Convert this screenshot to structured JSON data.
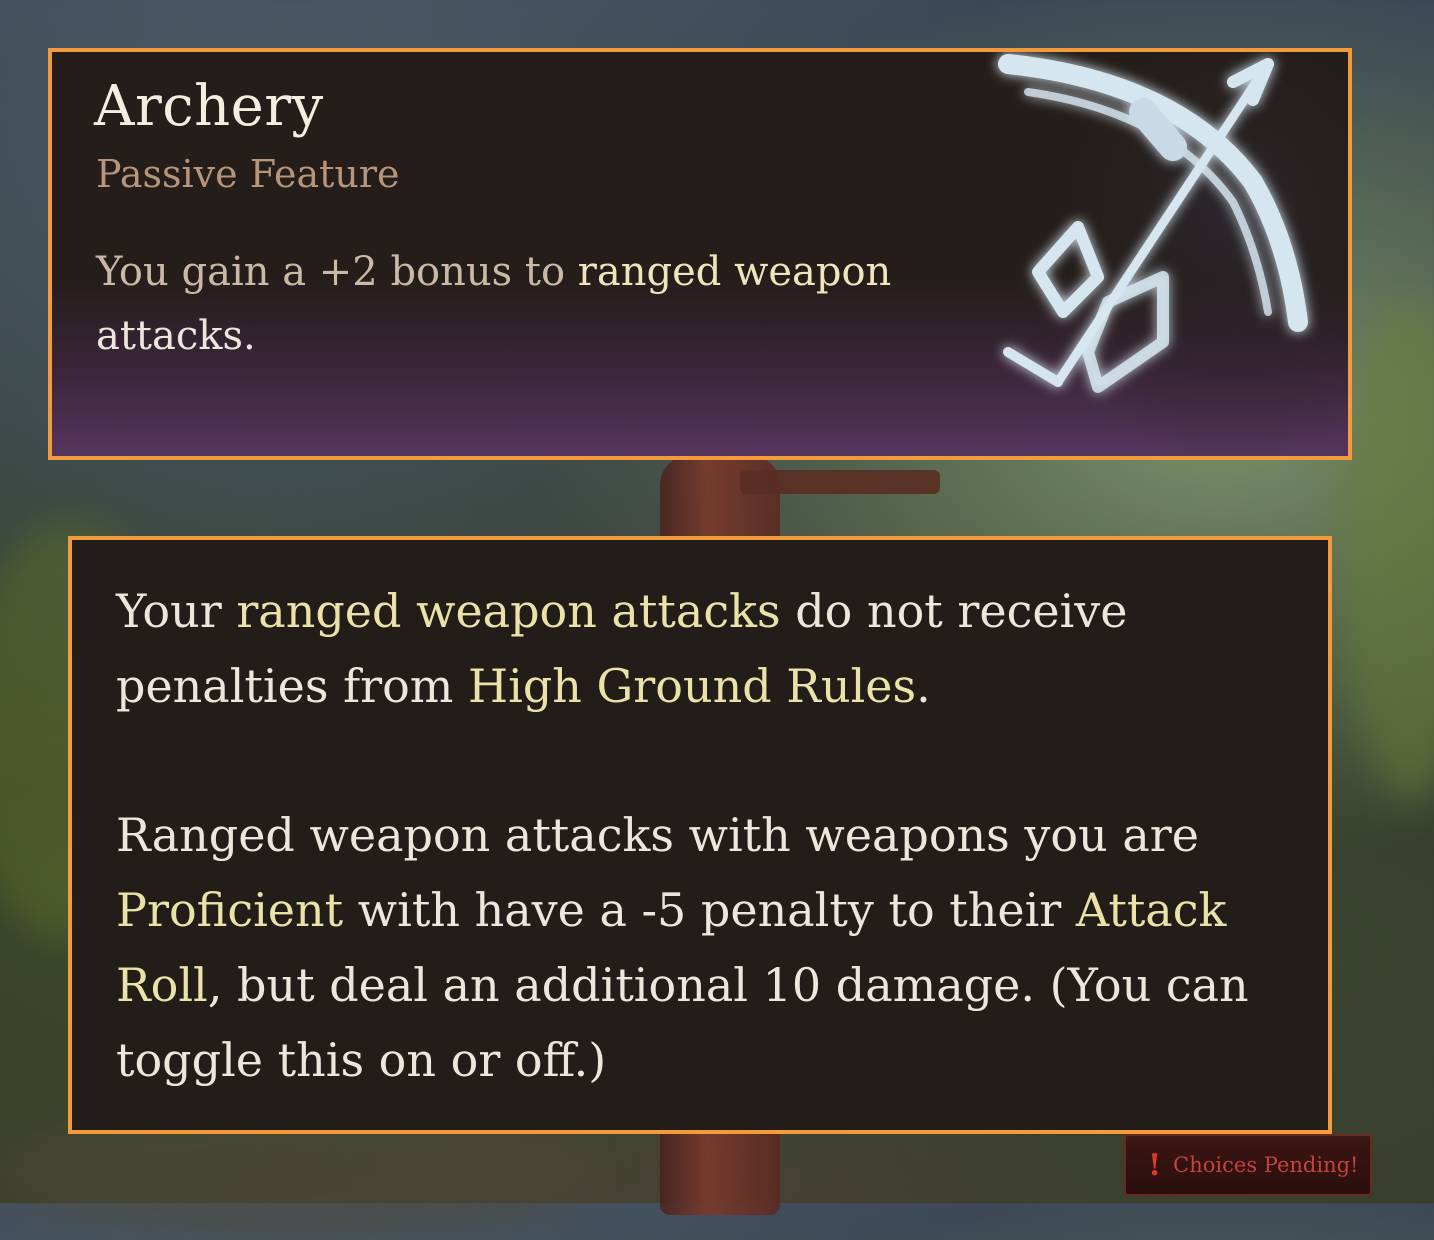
{
  "feature": {
    "title": "Archery",
    "subtitle": "Passive Feature",
    "description_prefix": "You gain a +2 bonus to ",
    "description_highlight": "ranged weapon",
    "description_suffix": "attacks.",
    "icon": "bow-and-arrow-icon"
  },
  "details": {
    "p1_a": "Your ",
    "p1_hl1": "ranged weapon attacks",
    "p1_b": " do not receive penalties from ",
    "p1_hl2": "High Ground Rules",
    "p1_c": ".",
    "p2_a": "Ranged weapon attacks with weapons you are ",
    "p2_hl1": "Proficient",
    "p2_b": " with have a -5 penalty to their ",
    "p2_hl2": "Attack Roll",
    "p2_c": ", but deal an additional 10 damage. (You can toggle this on or off.)"
  },
  "choices_button": {
    "label": "Choices Pending!",
    "icon": "exclamation-icon"
  },
  "colors": {
    "highlight_border": "#f39a3a",
    "keyword": "#e9e3a8"
  }
}
